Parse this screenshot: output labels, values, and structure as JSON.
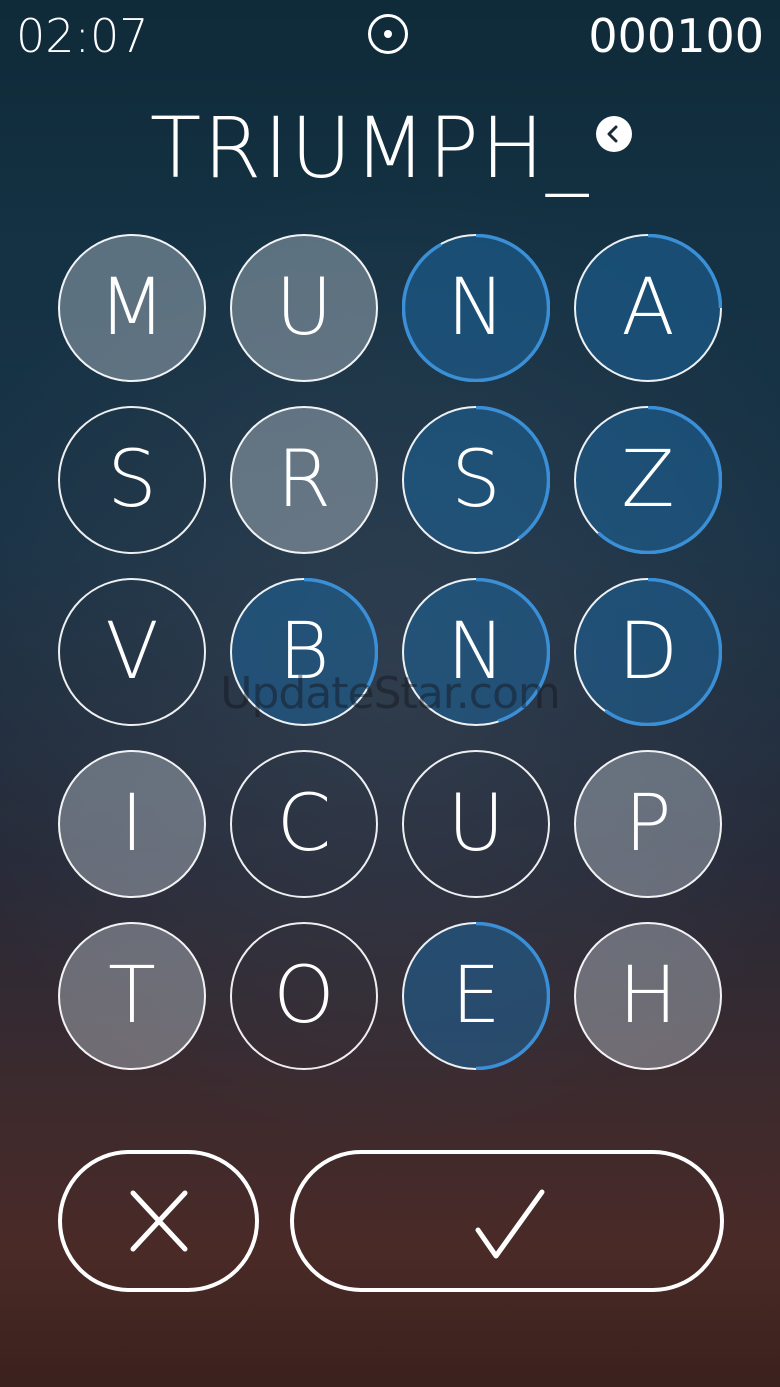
{
  "header": {
    "timer": "02:07",
    "score": "000100",
    "pause_icon": "pause-circle-icon"
  },
  "word": {
    "current": "TRIUMPH_",
    "backspace_icon": "backspace-chevron-left-icon"
  },
  "grid": {
    "rows": [
      [
        {
          "letter": "M",
          "state": "selected",
          "timer_fraction": 0
        },
        {
          "letter": "U",
          "state": "selected",
          "timer_fraction": 0
        },
        {
          "letter": "N",
          "state": "bonus",
          "timer_fraction": 0.92
        },
        {
          "letter": "A",
          "state": "bonus",
          "timer_fraction": 0.25
        }
      ],
      [
        {
          "letter": "S",
          "state": "unused",
          "timer_fraction": 0
        },
        {
          "letter": "R",
          "state": "selected",
          "timer_fraction": 0
        },
        {
          "letter": "S",
          "state": "bonus",
          "timer_fraction": 0.4
        },
        {
          "letter": "Z",
          "state": "bonus",
          "timer_fraction": 0.62
        }
      ],
      [
        {
          "letter": "V",
          "state": "unused",
          "timer_fraction": 0
        },
        {
          "letter": "B",
          "state": "bonus",
          "timer_fraction": 0.33
        },
        {
          "letter": "N",
          "state": "bonus",
          "timer_fraction": 0.45
        },
        {
          "letter": "D",
          "state": "bonus",
          "timer_fraction": 0.6
        }
      ],
      [
        {
          "letter": "I",
          "state": "selected",
          "timer_fraction": 0
        },
        {
          "letter": "C",
          "state": "unused",
          "timer_fraction": 0
        },
        {
          "letter": "U",
          "state": "unused",
          "timer_fraction": 0
        },
        {
          "letter": "P",
          "state": "selected",
          "timer_fraction": 0
        }
      ],
      [
        {
          "letter": "T",
          "state": "selected",
          "timer_fraction": 0
        },
        {
          "letter": "O",
          "state": "unused",
          "timer_fraction": 0
        },
        {
          "letter": "E",
          "state": "bonus",
          "timer_fraction": 0.5
        },
        {
          "letter": "H",
          "state": "selected",
          "timer_fraction": 0
        }
      ]
    ]
  },
  "watermark": "UpdateStar.com",
  "actions": {
    "cancel_icon": "x-icon",
    "confirm_icon": "checkmark-icon"
  },
  "colors": {
    "timer_ring": "#3a8fd6",
    "bonus_fill": "#1e649b",
    "selected_fill": "#bec8d2"
  }
}
